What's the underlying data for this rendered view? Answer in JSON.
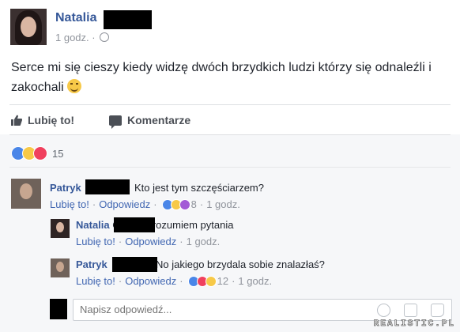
{
  "post": {
    "author": "Natalia",
    "time": "1 godz. ·",
    "text": "Serce mi się cieszy kiedy widzę dwóch brzydkich ludzi którzy się odnaleźli i zakochali",
    "like_label": "Lubię to!",
    "comment_label": "Komentarze",
    "reactions_count": "15"
  },
  "comments": [
    {
      "author": "Patryk",
      "text": "Kto jest tym szczęściarzem?",
      "like": "Lubię to!",
      "reply": "Odpowiedz",
      "sep": "·",
      "reactions": "8",
      "time": "1 godz."
    },
    {
      "author": "Natalia",
      "text": "Co? Nie rozumiem pytania",
      "like": "Lubię to!",
      "reply": "Odpowiedz",
      "sep": "·",
      "time": "1 godz."
    },
    {
      "author": "Patryk",
      "text": "No jakiego brzydala sobie znalazłaś?",
      "like": "Lubię to!",
      "reply": "Odpowiedz",
      "sep": "·",
      "reactions": "12",
      "time": "1 godz."
    }
  ],
  "reply_box": {
    "placeholder": "Napisz odpowiedź..."
  },
  "watermark": "REALISTIC.PL",
  "colors": {
    "link": "#365899",
    "action": "#4267b2",
    "muted": "#90949c"
  },
  "icons": [
    "globe-icon",
    "like-icon",
    "comment-icon",
    "smiley-emoji-icon",
    "emoji-icon",
    "camera-icon",
    "sticker-icon"
  ]
}
